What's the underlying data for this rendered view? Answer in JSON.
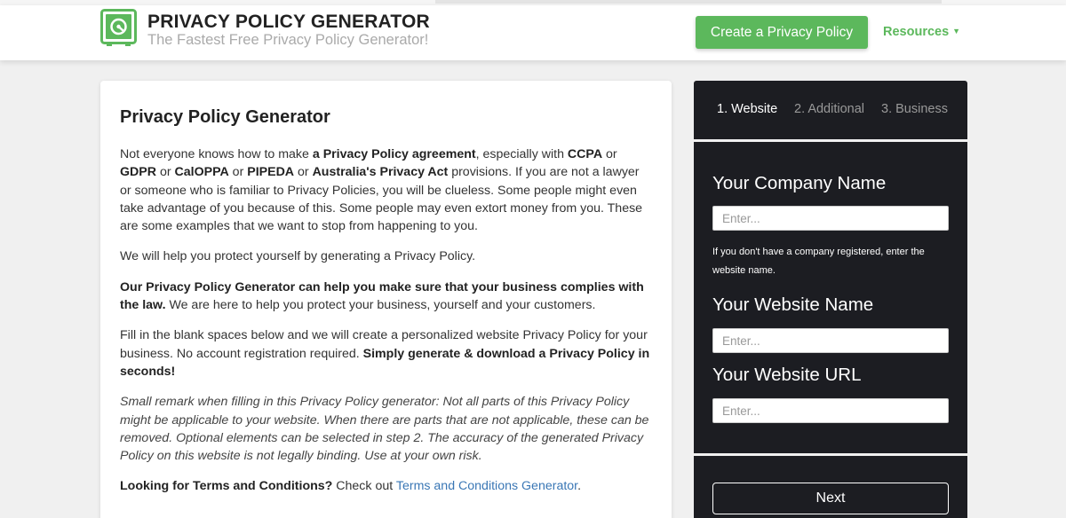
{
  "header": {
    "brand_title": "PRIVACY POLICY GENERATOR",
    "brand_tagline": "The Fastest Free Privacy Policy Generator!",
    "cta_label": "Create a Privacy Policy",
    "resources_label": "Resources",
    "logo_icon": "safe-icon",
    "brand_color": "#5cb85c"
  },
  "main": {
    "title": "Privacy Policy Generator",
    "p1": {
      "t1": "Not everyone knows how to make ",
      "b1": "a Privacy Policy agreement",
      "t2": ", especially with ",
      "b2": "CCPA",
      "t3": " or ",
      "b3": "GDPR",
      "t4": " or ",
      "b4": "CalOPPA",
      "t5": " or ",
      "b5": "PIPEDA",
      "t6": " or ",
      "b6": "Australia's Privacy Act",
      "t7": " provisions. If you are not a lawyer or someone who is familiar to Privacy Policies, you will be clueless. Some people might even take advantage of you because of this. Some people may even extort money from you. These are some examples that we want to stop from happening to you."
    },
    "p2": "We will help you protect yourself by generating a Privacy Policy.",
    "p3": {
      "b1": "Our Privacy Policy Generator can help you make sure that your business complies with the law.",
      "t1": " We are here to help you protect your business, yourself and your customers."
    },
    "p4": {
      "t1": "Fill in the blank spaces below and we will create a personalized website Privacy Policy for your business. No account registration required. ",
      "b1": "Simply generate & download a Privacy Policy in seconds!"
    },
    "p5": "Small remark when filling in this Privacy Policy generator: Not all parts of this Privacy Policy might be applicable to your website. When there are parts that are not applicable, these can be removed. Optional elements can be selected in step 2. The accuracy of the generated Privacy Policy on this website is not legally binding. Use at your own risk.",
    "p6": {
      "b1": "Looking for Terms and Conditions?",
      "t1": " Check out ",
      "link": "Terms and Conditions Generator",
      "t2": "."
    }
  },
  "sidebar": {
    "steps": [
      "1. Website",
      "2. Additional",
      "3. Business"
    ],
    "company_label": "Your Company Name",
    "company_placeholder": "Enter...",
    "company_note": "If you don't have a company registered, enter the website name.",
    "website_label": "Your Website Name",
    "website_placeholder": "Enter...",
    "url_label": "Your Website URL",
    "url_placeholder": "Enter...",
    "next_label": "Next"
  }
}
